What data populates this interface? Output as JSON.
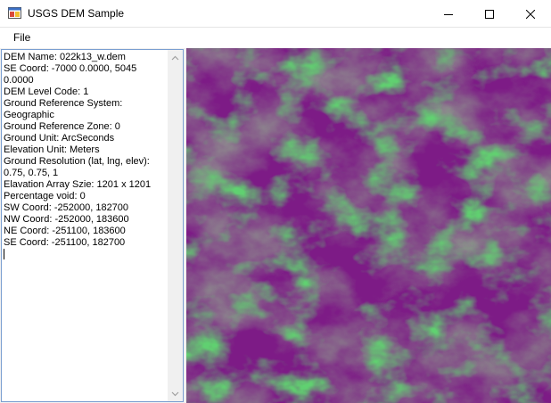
{
  "window": {
    "title": "USGS DEM Sample"
  },
  "menu": {
    "items": [
      "File"
    ]
  },
  "info_lines": [
    "DEM Name: 022k13_w.dem",
    "SE Coord: -7000 0.0000, 5045 0.0000",
    "DEM Level Code: 1",
    "Ground Reference System: Geographic",
    "Ground Reference Zone: 0",
    "Ground Unit: ArcSeconds",
    "Elevation Unit: Meters",
    "Ground Resolution (lat, lng, elev): 0.75, 0.75, 1",
    "Elavation Array Szie: 1201 x 1201",
    "Percentage void: 0",
    "SW Coord: -252000, 182700",
    "NW Coord: -252000, 183600",
    "NE Coord: -251100, 183600",
    "SE Coord: -251100, 182700"
  ],
  "colors": {
    "low": "#7d1b86",
    "mid": "#8b8b8b",
    "high": "#5fd96f"
  },
  "icons": {
    "app": "app-window-icon",
    "minimize": "minimize-icon",
    "maximize": "maximize-icon",
    "close": "close-icon"
  }
}
